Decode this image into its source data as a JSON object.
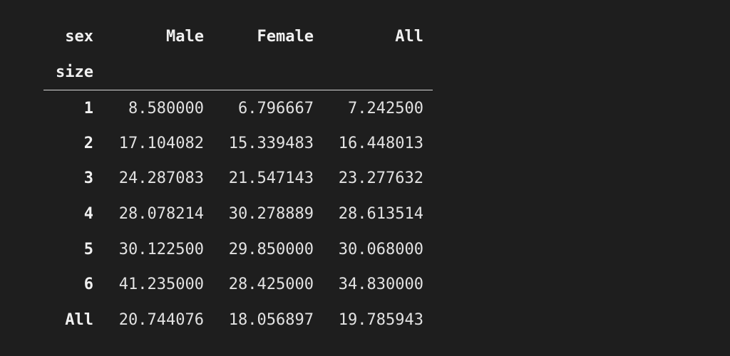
{
  "table": {
    "columns_name": "sex",
    "index_name": "size",
    "columns": [
      "Male",
      "Female",
      "All"
    ],
    "rows": [
      {
        "index": "1",
        "values": [
          "8.580000",
          "6.796667",
          "7.242500"
        ]
      },
      {
        "index": "2",
        "values": [
          "17.104082",
          "15.339483",
          "16.448013"
        ]
      },
      {
        "index": "3",
        "values": [
          "24.287083",
          "21.547143",
          "23.277632"
        ]
      },
      {
        "index": "4",
        "values": [
          "28.078214",
          "30.278889",
          "28.613514"
        ]
      },
      {
        "index": "5",
        "values": [
          "30.122500",
          "29.850000",
          "30.068000"
        ]
      },
      {
        "index": "6",
        "values": [
          "41.235000",
          "28.425000",
          "34.830000"
        ]
      },
      {
        "index": "All",
        "values": [
          "20.744076",
          "18.056897",
          "19.785943"
        ]
      }
    ]
  },
  "colors": {
    "background": "#1e1e1e",
    "text": "#e6e6e6",
    "rule": "#d8d8d8"
  }
}
